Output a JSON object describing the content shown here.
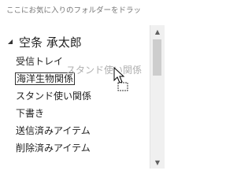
{
  "favorites": {
    "placeholder": "ここにお気に入りのフォルダーをドラッ"
  },
  "account": {
    "name": "空条 承太郎",
    "expand_icon": "expanded-triangle-icon"
  },
  "folders": [
    {
      "label": "受信トレイ"
    },
    {
      "label": "海洋生物関係"
    },
    {
      "label": "スタンド使い関係"
    },
    {
      "label": "下書き"
    },
    {
      "label": "送信済みアイテム"
    },
    {
      "label": "削除済みアイテム"
    }
  ],
  "drag": {
    "ghost_label": "スタンド使い関係",
    "cursor_icon": "move-cursor-icon"
  },
  "scrollbar": {
    "up_icon": "scroll-up-icon",
    "down_icon": "scroll-down-icon"
  }
}
